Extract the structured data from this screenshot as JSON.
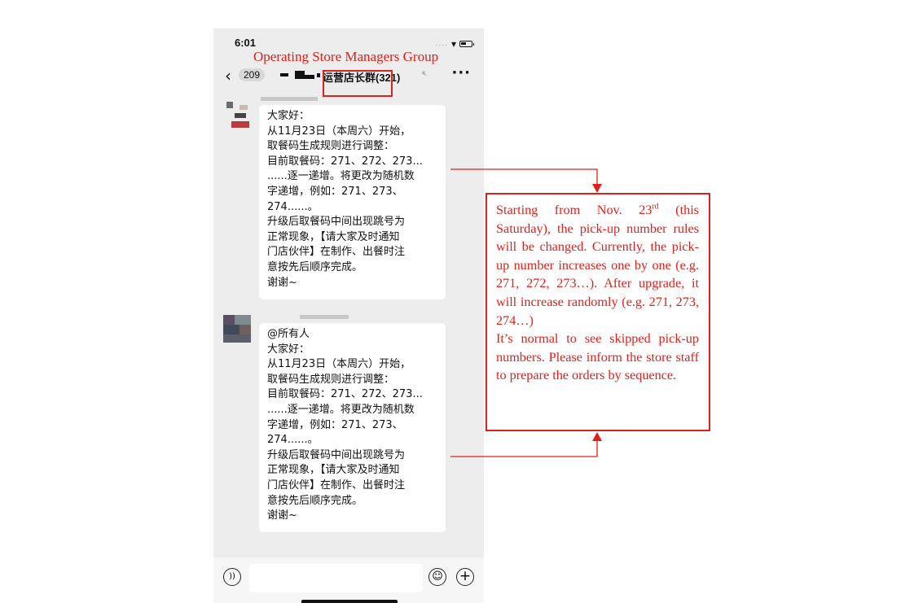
{
  "status_bar": {
    "time": "6:01"
  },
  "annotation": {
    "group_name_translation": "Operating Store Managers Group"
  },
  "header": {
    "back_icon": "chevron-left-icon",
    "unread_count": "209",
    "title_visible": "运营店长群(321)",
    "more_icon": "more-dots-icon"
  },
  "messages": [
    {
      "lines": [
        "大家好：",
        "从11月23日（本周六）开始，",
        "取餐码生成规则进行调整：",
        "目前取餐码：271、272、273...",
        "......逐一递增。将更改为随机数",
        "字递增，例如：271、273、",
        "274......。",
        "升级后取餐码中间出现跳号为",
        "正常现象，【请大家及时通知",
        "门店伙伴】在制作、出餐时注",
        "意按先后顺序完成。",
        "谢谢~"
      ]
    },
    {
      "lines": [
        "@所有人",
        "大家好：",
        "从11月23日（本周六）开始，",
        "取餐码生成规则进行调整：",
        "目前取餐码：271、272、273...",
        "......逐一递增。将更改为随机数",
        "字递增，例如：271、273、",
        "274......。",
        "升级后取餐码中间出现跳号为",
        "正常现象，【请大家及时通知",
        "门店伙伴】在制作、出餐时注",
        "意按先后顺序完成。",
        "谢谢~"
      ]
    }
  ],
  "translation": {
    "part1": "Starting from Nov. 23",
    "sup": "rd",
    "part2": " (this Saturday), the pick-up number rules will be changed. Currently, the pick-up number increases one by one (e.g. 271, 272, 273…). After upgrade, it will increase randomly (e.g. 271, 273, 274…)",
    "part3": "It’s normal to see skipped pick-up numbers. Please inform the store staff to prepare the orders by sequence."
  },
  "input_bar": {
    "voice_icon": "voice-icon",
    "emoji_icon": "emoji-icon",
    "plus_icon": "plus-icon"
  },
  "colors": {
    "annotation_red": "#e0201b",
    "chat_background": "#ededed",
    "bubble": "#ffffff"
  }
}
